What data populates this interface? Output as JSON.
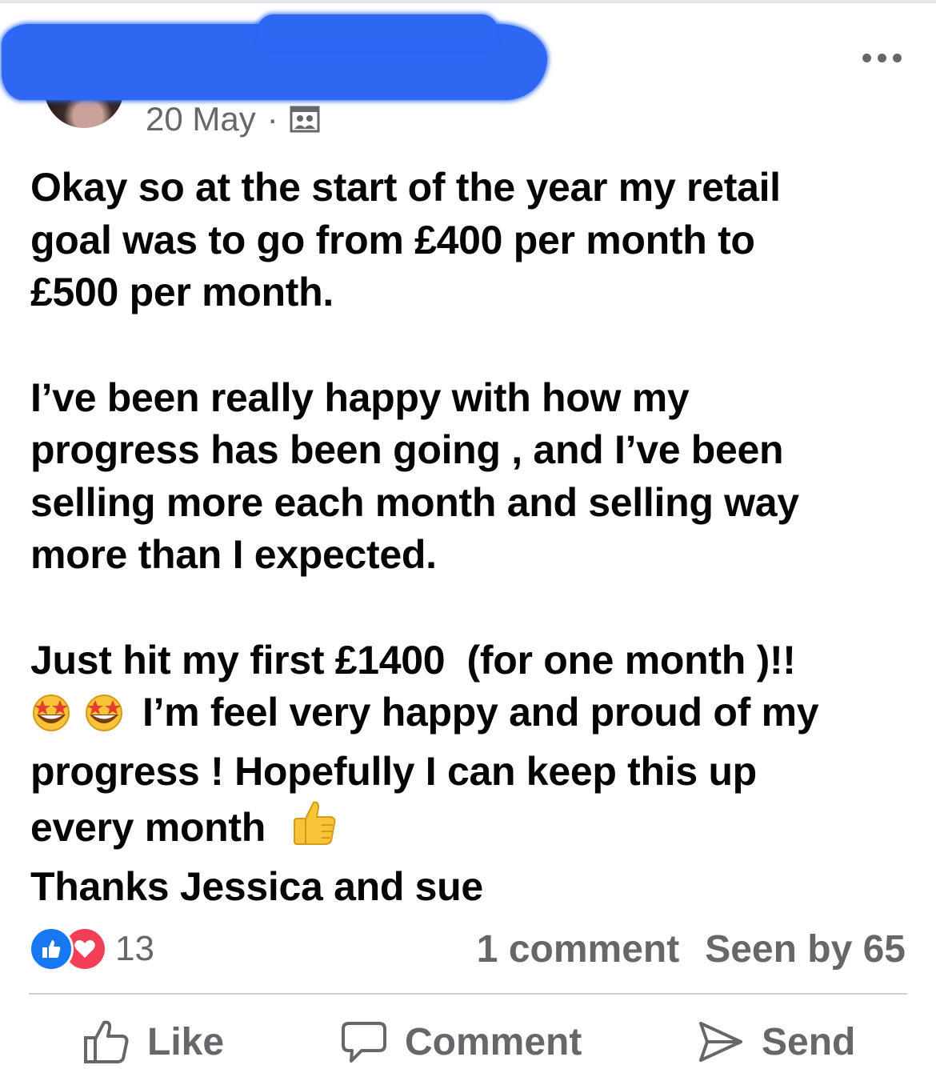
{
  "post": {
    "date": "20 May",
    "separator": "·",
    "audience_icon": "group-icon",
    "more_icon": "more-options-icon",
    "paragraphs": [
      [
        "Okay so at the start of the year my retail",
        "goal was to go from £400 per month to",
        "£500 per month."
      ],
      [
        "I’ve been really happy with how my",
        "progress has been going , and I’ve been",
        "selling more each month and selling way",
        "more than I expected."
      ]
    ],
    "para3": {
      "line1": "Just hit my first £1400  (for one month )!!",
      "line2_emoji": "star-struck-emoji",
      "line2": "I’m feel very happy and proud of my",
      "line3": "progress ! Hopefully I can keep this up",
      "line4": "every month",
      "line4_emoji": "thumbs-up-emoji",
      "line5": "Thanks Jessica and sue"
    }
  },
  "stats": {
    "reaction_icons": [
      "like-reaction-icon",
      "love-reaction-icon"
    ],
    "reaction_count": "13",
    "comments": "1 comment",
    "seen_by": "Seen by 65"
  },
  "actions": {
    "like": "Like",
    "comment": "Comment",
    "send": "Send"
  },
  "colors": {
    "text": "#050505",
    "secondary": "#65676b",
    "like_blue": "#1877f2",
    "love_red": "#f33e58",
    "redaction": "#2d67f2"
  }
}
